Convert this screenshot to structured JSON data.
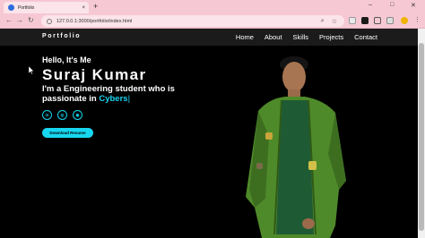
{
  "browser": {
    "tab_title": "Portfolio",
    "tab_close": "×",
    "new_tab": "+",
    "url": "127.0.0.1:3000/portfolio/index.html",
    "controls": {
      "minimize": "–",
      "maximize": "□",
      "close": "✕"
    },
    "nav": {
      "back": "←",
      "forward": "→",
      "reload": "↻"
    }
  },
  "site": {
    "brand": "Portfolio",
    "nav": [
      "Home",
      "About",
      "Skills",
      "Projects",
      "Contact"
    ]
  },
  "hero": {
    "greeting": "Hello, It's Me",
    "name": "Suraj Kumar",
    "tagline_line1": "I'm a Engineering student who is",
    "tagline_line2_prefix": "passionate in ",
    "typed_word": "Cybers",
    "cursor": "|",
    "socials": [
      {
        "icon": "linkedin-icon",
        "glyph": "in"
      },
      {
        "icon": "instagram-icon",
        "glyph": "◎"
      },
      {
        "icon": "github-icon",
        "glyph": "◉"
      }
    ],
    "download_label": "Download Resume"
  },
  "colors": {
    "accent": "#17d6f0",
    "chrome": "#f6c8d4",
    "navbar": "#1b1b1b"
  }
}
